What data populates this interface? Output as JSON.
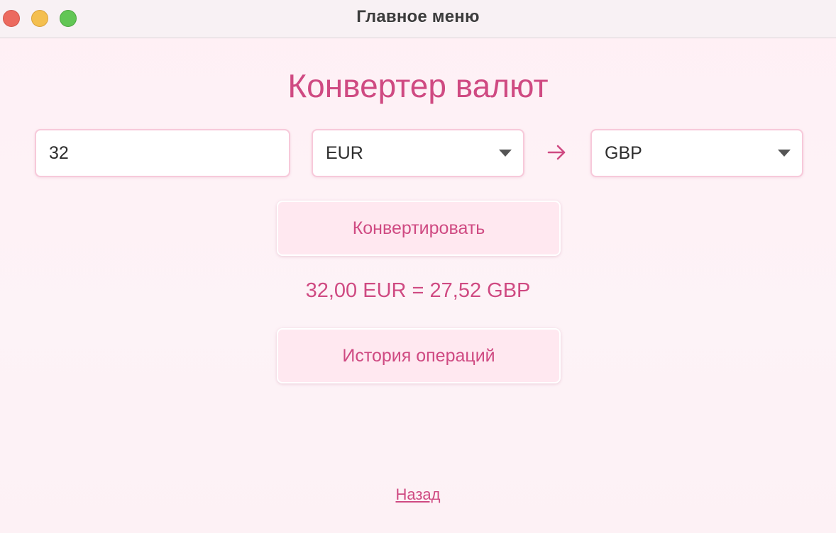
{
  "window": {
    "title": "Главное меню"
  },
  "converter": {
    "title": "Конвертер валют",
    "amount_value": "32",
    "from_currency": "EUR",
    "to_currency": "GBP",
    "convert_label": "Конвертировать",
    "result_text": "32,00 EUR = 27,52 GBP",
    "history_label": "История операций",
    "back_label": "Назад"
  },
  "icons": {
    "arrow": "arrow-right-icon",
    "caret": "chevron-down-icon"
  },
  "colors": {
    "accent": "#cf4a82",
    "button_bg": "#ffe8f0",
    "field_border": "#f7c9da",
    "close": "#ec6a5f",
    "minimize": "#f4bf4f",
    "zoom": "#62c655"
  }
}
